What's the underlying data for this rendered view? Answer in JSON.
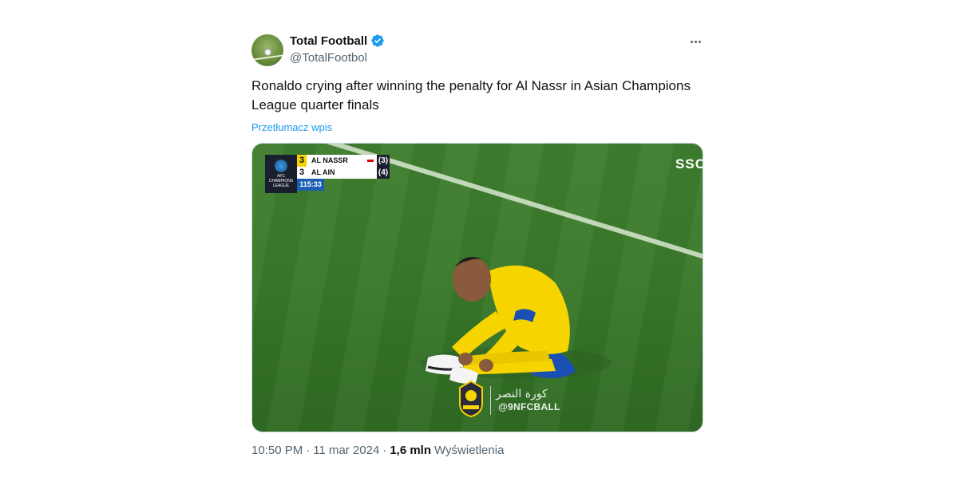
{
  "account": {
    "name": "Total Football",
    "handle": "@TotalFootbol",
    "verified": true,
    "avatar_icon": "football-pitch-avatar"
  },
  "tweet": {
    "text": "Ronaldo crying after winning the penalty for Al Nassr in Asian Champions League quarter finals",
    "translate_label": "Przetłumacz wpis",
    "time": "10:50 PM",
    "separator": "·",
    "date": "11 mar 2024",
    "views_count": "1,6 mln",
    "views_label": "Wyświetlenia"
  },
  "media": {
    "competition_line1": "AFC",
    "competition_line2": "CHAMPIONS",
    "competition_line3": "LEAGUE",
    "home_team": "AL NASSR",
    "home_score": "3",
    "home_pens": "(3)",
    "away_team": "AL AIN",
    "away_score": "3",
    "away_pens": "(4)",
    "clock": "115:33",
    "broadcaster": "SSC",
    "watermark_arabic": "كورة النصر",
    "watermark_handle": "@9NFCBALL"
  },
  "colors": {
    "accent": "#1d9bf0",
    "text_secondary": "#536471",
    "jersey": "#f5d400",
    "shorts": "#1a4fb4"
  }
}
